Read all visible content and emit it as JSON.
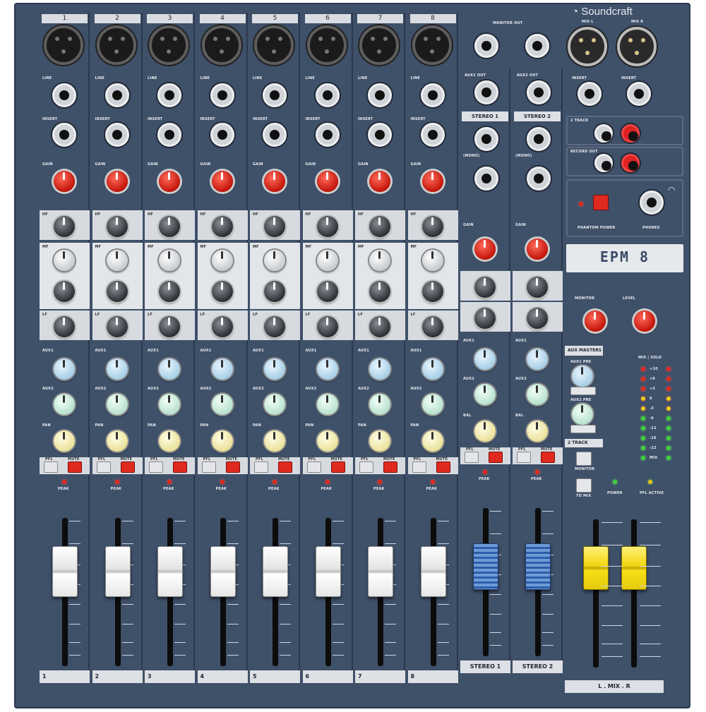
{
  "brand": {
    "name": "Soundcraft",
    "model": "EPM 8"
  },
  "channels": [
    {
      "number": "1",
      "label": "1"
    },
    {
      "number": "2",
      "label": "2"
    },
    {
      "number": "3",
      "label": "3"
    },
    {
      "number": "4",
      "label": "4"
    },
    {
      "number": "5",
      "label": "5"
    },
    {
      "number": "6",
      "label": "6"
    },
    {
      "number": "7",
      "label": "7"
    },
    {
      "number": "8",
      "label": "8"
    }
  ],
  "channel_text": {
    "line": "LINE",
    "insert": "INSERT",
    "gain": "GAIN",
    "hf": "HF",
    "mf": "MF",
    "lf": "LF",
    "aux1": "AUX1",
    "aux2": "AUX2",
    "pan": "PAN",
    "pfl": "PFL",
    "mute": "MUTE",
    "peak": "PEAK"
  },
  "stereo_channels": [
    {
      "label": "STEREO 1",
      "header": "STEREO 1",
      "aux_out": "AUX1 OUT"
    },
    {
      "label": "STEREO 2",
      "header": "STEREO 2",
      "aux_out": "AUX2 OUT"
    }
  ],
  "stereo_text": {
    "bal": "BAL",
    "gain": "GAIN",
    "mono": "(MONO)"
  },
  "master": {
    "monitor_out": "MONITOR OUT",
    "mix_l": "MIX L",
    "mix_r": "MIX R",
    "insert": "INSERT",
    "two_track": "2 TRACK",
    "record_out": "RECORD OUT",
    "phantom_power": "PHANTOM POWER",
    "phones": "PHONES",
    "monitor": "MONITOR",
    "level": "LEVEL",
    "aux_masters": "AUX MASTERS",
    "aux1_pre": "AUX1 PRE",
    "aux2_pre": "AUX2 PRE",
    "two_track_label": "2 TRACK",
    "monitor_button": "MONITOR",
    "to_mix_button": "TO MIX",
    "power": "POWER",
    "pfl_active": "PFL ACTIVE",
    "meter_header": "MIX | SOLO",
    "meter_scale": [
      "+10",
      "+6",
      "+3",
      "0",
      "-3",
      "-6",
      "-12",
      "-16",
      "-22",
      "MIX"
    ],
    "mix_label": "L . MIX . R"
  }
}
